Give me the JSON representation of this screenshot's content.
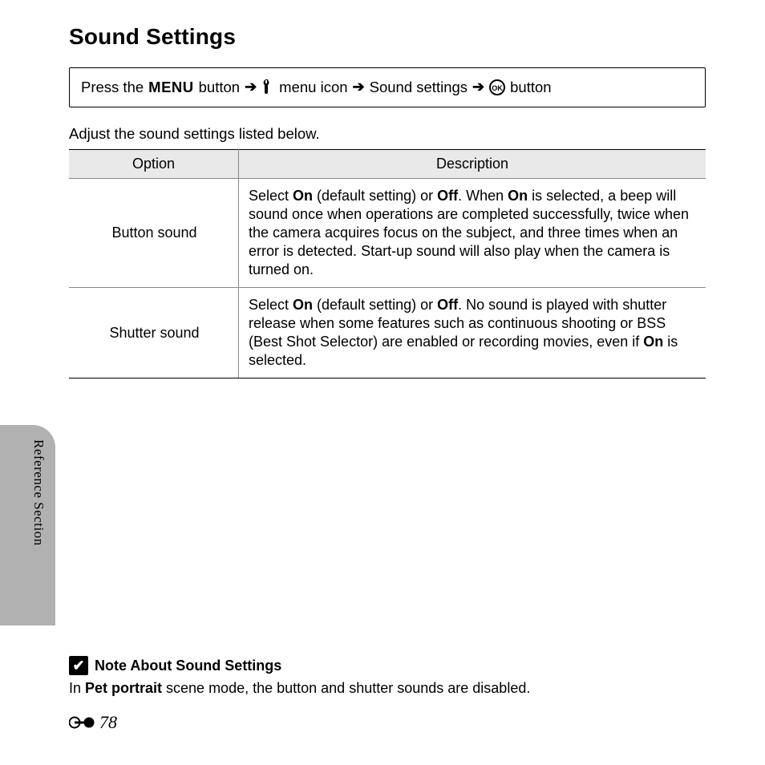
{
  "title": "Sound Settings",
  "nav": {
    "prefix": "Press the",
    "menu_btn": "MENU",
    "after_menu": "button",
    "menu_icon_text": "menu icon",
    "item": "Sound settings",
    "after_ok": "button"
  },
  "intro": "Adjust the sound settings listed below.",
  "table": {
    "h_option": "Option",
    "h_desc": "Description",
    "r1": {
      "opt": "Button sound",
      "d1": "Select ",
      "d1b": "On",
      "d2": " (default setting) or ",
      "d2b": "Off",
      "d3": ". When ",
      "d3b": "On",
      "d4": " is selected, a beep will sound once when operations are completed successfully, twice when the camera acquires focus on the subject, and three times when an error is detected. Start-up sound will also play when the camera is turned on."
    },
    "r2": {
      "opt": "Shutter sound",
      "d1": "Select ",
      "d1b": "On",
      "d2": " (default setting) or ",
      "d2b": "Off",
      "d3": ". No sound is played with shutter release when some features such as continuous shooting or BSS (Best Shot Selector) are enabled or recording movies, even if ",
      "d3b": "On",
      "d4": " is selected."
    }
  },
  "side_label": "Reference Section",
  "note": {
    "title": "Note About Sound Settings",
    "b1": "In ",
    "b1b": "Pet portrait",
    "b2": " scene mode, the button and shutter sounds are disabled."
  },
  "page_number": "78"
}
